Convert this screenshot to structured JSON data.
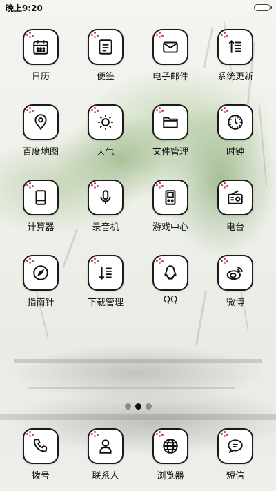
{
  "status_bar": {
    "time": "晚上9:20"
  },
  "apps": [
    {
      "label": "日历",
      "icon": "calendar-icon"
    },
    {
      "label": "便签",
      "icon": "note-icon"
    },
    {
      "label": "电子邮件",
      "icon": "mail-icon"
    },
    {
      "label": "系统更新",
      "icon": "update-icon"
    },
    {
      "label": "百度地图",
      "icon": "map-pin-icon"
    },
    {
      "label": "天气",
      "icon": "sun-icon"
    },
    {
      "label": "文件管理",
      "icon": "folder-icon"
    },
    {
      "label": "时钟",
      "icon": "clock-icon"
    },
    {
      "label": "计算器",
      "icon": "calculator-icon"
    },
    {
      "label": "录音机",
      "icon": "microphone-icon"
    },
    {
      "label": "游戏中心",
      "icon": "gameboy-icon"
    },
    {
      "label": "电台",
      "icon": "radio-icon"
    },
    {
      "label": "指南针",
      "icon": "compass-icon"
    },
    {
      "label": "下载管理",
      "icon": "download-list-icon"
    },
    {
      "label": "QQ",
      "icon": "qq-penguin-icon"
    },
    {
      "label": "微博",
      "icon": "weibo-icon"
    }
  ],
  "page_indicator": {
    "pages": 3,
    "current": 2
  },
  "dock": [
    {
      "label": "拨号",
      "icon": "phone-icon"
    },
    {
      "label": "联系人",
      "icon": "contact-icon"
    },
    {
      "label": "浏览器",
      "icon": "globe-icon"
    },
    {
      "label": "短信",
      "icon": "message-icon"
    }
  ],
  "colors": {
    "icon_border": "#1a1a1a",
    "blossom": "#c0395a",
    "wallpaper_green": "#78a05a"
  }
}
